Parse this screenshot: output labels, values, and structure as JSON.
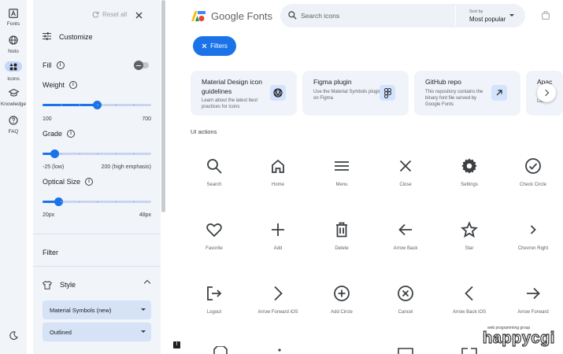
{
  "rail": {
    "items": [
      {
        "label": "Fonts"
      },
      {
        "label": "Noto"
      },
      {
        "label": "Icons"
      },
      {
        "label": "Knowledge"
      },
      {
        "label": "FAQ"
      }
    ]
  },
  "panel": {
    "reset_label": "Reset all",
    "title": "Customize",
    "fill_label": "Fill",
    "fill_enabled": false,
    "weight": {
      "label": "Weight",
      "min_label": "100",
      "max_label": "700",
      "min": 100,
      "max": 700,
      "value": 400
    },
    "grade": {
      "label": "Grade",
      "min_label": "-25 (low)",
      "max_label": "200 (high emphasis)",
      "min": -25,
      "max": 200,
      "value": 0
    },
    "optical_size": {
      "label": "Optical Size",
      "min_label": "20px",
      "max_label": "48px",
      "min": 20,
      "max": 48,
      "value": 24
    },
    "filter_label": "Filter",
    "style_label": "Style",
    "style_select": "Material Symbols (new)",
    "variant_select": "Outlined"
  },
  "header": {
    "logo_text": "Google Fonts",
    "search_placeholder": "Search icons",
    "sort_caption": "Sort by",
    "sort_value": "Most popular",
    "filters_label": "Filters"
  },
  "cards": [
    {
      "title": "Material Design icon guidelines",
      "desc": "Learn about the latest best practices for icons"
    },
    {
      "title": "Figma plugin",
      "desc": "Use the Material Symbols plugin on Figma"
    },
    {
      "title": "GitHub repo",
      "desc": "This repository contains the binary font file served by Google Fonts"
    },
    {
      "title": "Apac",
      "desc": "Licen"
    }
  ],
  "category": "UI actions",
  "icons": [
    {
      "name": "Search",
      "icon": "search-icon"
    },
    {
      "name": "Home",
      "icon": "home-icon"
    },
    {
      "name": "Menu",
      "icon": "menu-icon"
    },
    {
      "name": "Close",
      "icon": "close-icon"
    },
    {
      "name": "Settings",
      "icon": "settings-icon"
    },
    {
      "name": "Check Circle",
      "icon": "check-circle-icon"
    },
    {
      "name": "Favorite",
      "icon": "favorite-icon"
    },
    {
      "name": "Add",
      "icon": "add-icon"
    },
    {
      "name": "Delete",
      "icon": "delete-icon"
    },
    {
      "name": "Arrow Back",
      "icon": "arrow-back-icon"
    },
    {
      "name": "Star",
      "icon": "star-icon"
    },
    {
      "name": "Chevron Right",
      "icon": "chevron-right-icon"
    },
    {
      "name": "Logout",
      "icon": "logout-icon"
    },
    {
      "name": "Arrow Forward iOS",
      "icon": "arrow-forward-ios-icon"
    },
    {
      "name": "Add Circle",
      "icon": "add-circle-icon"
    },
    {
      "name": "Cancel",
      "icon": "cancel-icon"
    },
    {
      "name": "Arrow Back iOS",
      "icon": "arrow-back-ios-icon"
    },
    {
      "name": "Arrow Forward",
      "icon": "arrow-forward-icon"
    }
  ],
  "watermark": {
    "small": "web programming group",
    "big": "happycgi"
  },
  "colors": {
    "accent": "#1a73e8",
    "panel_bg": "#f1f4f9",
    "select_bg": "#d6e2f6"
  }
}
